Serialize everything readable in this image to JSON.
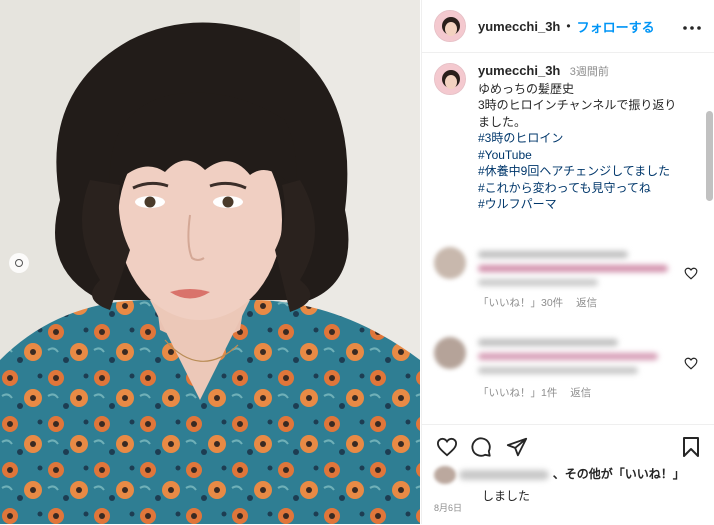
{
  "post": {
    "username": "yumecchi_3h",
    "separator": "•",
    "follow_label": "フォローする"
  },
  "caption": {
    "username": "yumecchi_3h",
    "time": "3週間前",
    "lines": [
      "ゆめっちの髪歴史",
      "3時のヒロインチャンネルで振り返りました。"
    ],
    "hashtags": [
      "#3時のヒロイン",
      "#YouTube",
      "#休養中9回ヘアチェンジしてました",
      "#これから変わっても見守ってね",
      "#ウルフパーマ"
    ]
  },
  "comments": [
    {
      "likes_label": "「いいね！」30件",
      "reply_label": "返信"
    },
    {
      "likes_label": "「いいね！」1件",
      "reply_label": "返信"
    }
  ],
  "footer": {
    "liked_by_suffix": "、その他が「いいね！」",
    "liked_by_line2": "しました",
    "date": "8月6日"
  },
  "icons": {
    "more": "more-horizontal-icon",
    "heart": "heart-icon",
    "comment": "comment-icon",
    "share": "share-icon",
    "save": "bookmark-icon",
    "carousel": "carousel-dot-icon"
  },
  "colors": {
    "accent": "#0095f6",
    "hashtag": "#00376b",
    "muted": "#8e8e8e"
  }
}
